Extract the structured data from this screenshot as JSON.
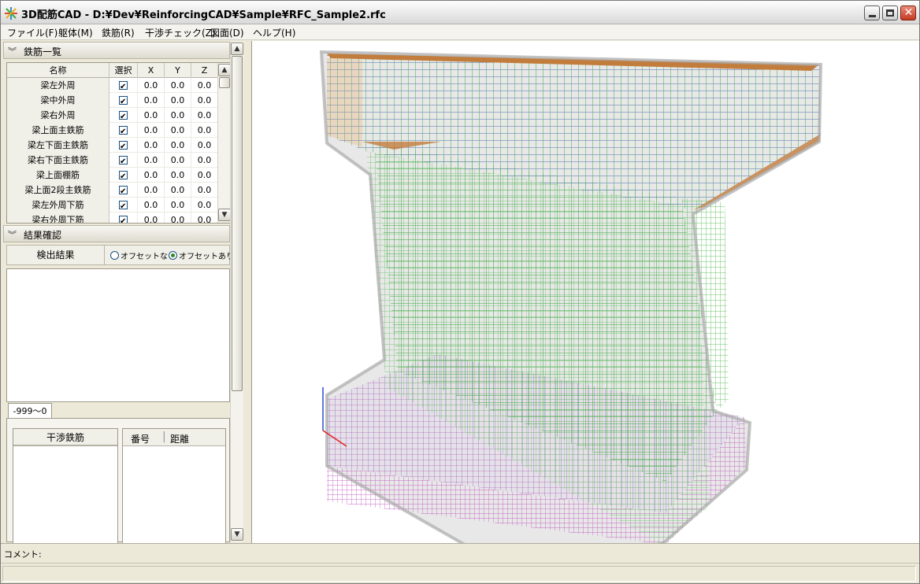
{
  "window": {
    "title": "3D配筋CAD - D:¥Dev¥ReinforcingCAD¥Sample¥RFC_Sample2.rfc",
    "app_icon": "star-icon",
    "controls": [
      "minimize-icon",
      "maximize-icon",
      "close-icon"
    ]
  },
  "menu": [
    "ファイル(F)",
    "躯体(M)",
    "鉄筋(R)",
    "干渉チェック(Z)",
    "図面(D)",
    "ヘルプ(H)"
  ],
  "rebar_list": {
    "section_title": "鉄筋一覧",
    "columns": [
      "名称",
      "選択",
      "X",
      "Y",
      "Z"
    ],
    "rows": [
      {
        "name": "梁左外周",
        "x": "0.0",
        "y": "0.0",
        "z": "0.0"
      },
      {
        "name": "梁中外周",
        "x": "0.0",
        "y": "0.0",
        "z": "0.0"
      },
      {
        "name": "梁右外周",
        "x": "0.0",
        "y": "0.0",
        "z": "0.0"
      },
      {
        "name": "梁上面主鉄筋",
        "x": "0.0",
        "y": "0.0",
        "z": "0.0"
      },
      {
        "name": "梁左下面主鉄筋",
        "x": "0.0",
        "y": "0.0",
        "z": "0.0"
      },
      {
        "name": "梁右下面主鉄筋",
        "x": "0.0",
        "y": "0.0",
        "z": "0.0"
      },
      {
        "name": "梁上面棚筋",
        "x": "0.0",
        "y": "0.0",
        "z": "0.0"
      },
      {
        "name": "梁上面2段主鉄筋",
        "x": "0.0",
        "y": "0.0",
        "z": "0.0"
      },
      {
        "name": "梁左外周下筋",
        "x": "0.0",
        "y": "0.0",
        "z": "0.0"
      },
      {
        "name": "梁右外周下筋",
        "x": "0.0",
        "y": "0.0",
        "z": "0.0"
      }
    ]
  },
  "result": {
    "section_title": "結果確認",
    "detect_label": "検出結果",
    "options": [
      {
        "label": "オフセットなし",
        "selected": false
      },
      {
        "label": "オフセットあり",
        "selected": true
      }
    ]
  },
  "interference": {
    "tab_label": "-999〜0",
    "list1_header": "干渉鉄筋",
    "list2_headers": [
      "番号",
      "距離"
    ]
  },
  "comment_label": "コメント:",
  "colors": {
    "rebar_green": "#4caf50",
    "rebar_blue": "#3a5fb0",
    "rebar_orange": "#c27c3c",
    "rebar_magenta": "#b04fb0"
  }
}
